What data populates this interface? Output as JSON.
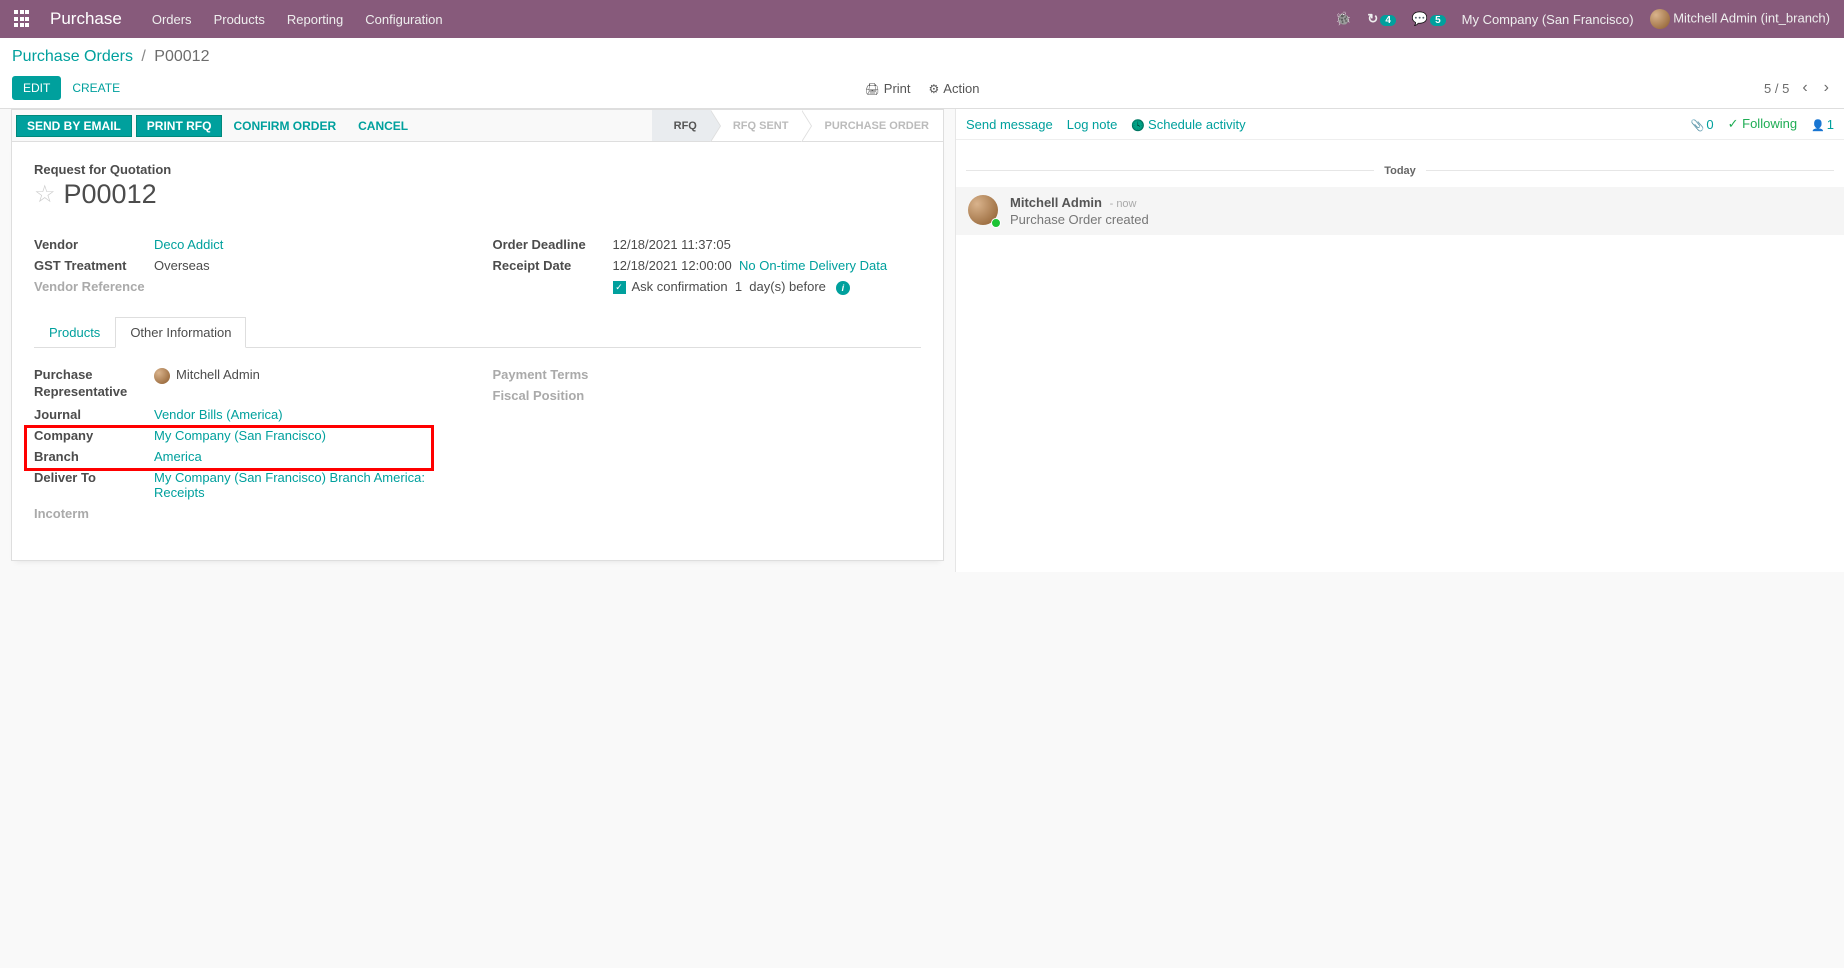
{
  "topbar": {
    "brand": "Purchase",
    "menu": [
      "Orders",
      "Products",
      "Reporting",
      "Configuration"
    ],
    "badge1": "4",
    "badge2": "5",
    "company": "My Company (San Francisco)",
    "user": "Mitchell Admin (int_branch)"
  },
  "breadcrumb": {
    "root": "Purchase Orders",
    "current": "P00012"
  },
  "buttons": {
    "edit": "EDIT",
    "create": "CREATE",
    "print": "Print",
    "action": "Action"
  },
  "pager": {
    "text": "5 / 5"
  },
  "workflow": {
    "send": "SEND BY EMAIL",
    "printrfq": "PRINT RFQ",
    "confirm": "CONFIRM ORDER",
    "cancel": "CANCEL",
    "steps": [
      "RFQ",
      "RFQ SENT",
      "PURCHASE ORDER"
    ]
  },
  "record": {
    "subtitle": "Request for Quotation",
    "name": "P00012",
    "vendor_label": "Vendor",
    "vendor": "Deco Addict",
    "gst_label": "GST Treatment",
    "gst": "Overseas",
    "vendorref_label": "Vendor Reference",
    "deadline_label": "Order Deadline",
    "deadline": "12/18/2021 11:37:05",
    "receipt_label": "Receipt Date",
    "receipt": "12/18/2021 12:00:00",
    "receipt_note": "No On-time Delivery Data",
    "askconf": "Ask confirmation",
    "askconf_days": "1",
    "askconf_suffix": "day(s) before"
  },
  "tabs": {
    "products": "Products",
    "other": "Other Information"
  },
  "other": {
    "rep_label": "Purchase Representative",
    "rep": "Mitchell Admin",
    "journal_label": "Journal",
    "journal": "Vendor Bills (America)",
    "company_label": "Company",
    "company": "My Company (San Francisco)",
    "branch_label": "Branch",
    "branch": "America",
    "deliver_label": "Deliver To",
    "deliver": "My Company (San Francisco) Branch America: Receipts",
    "incoterm_label": "Incoterm",
    "payterms_label": "Payment Terms",
    "fiscal_label": "Fiscal Position"
  },
  "chatter": {
    "send": "Send message",
    "log": "Log note",
    "schedule": "Schedule activity",
    "attach_count": "0",
    "following": "Following",
    "follower_count": "1",
    "today": "Today",
    "msg_author": "Mitchell Admin",
    "msg_time": "- now",
    "msg_body": "Purchase Order created"
  }
}
